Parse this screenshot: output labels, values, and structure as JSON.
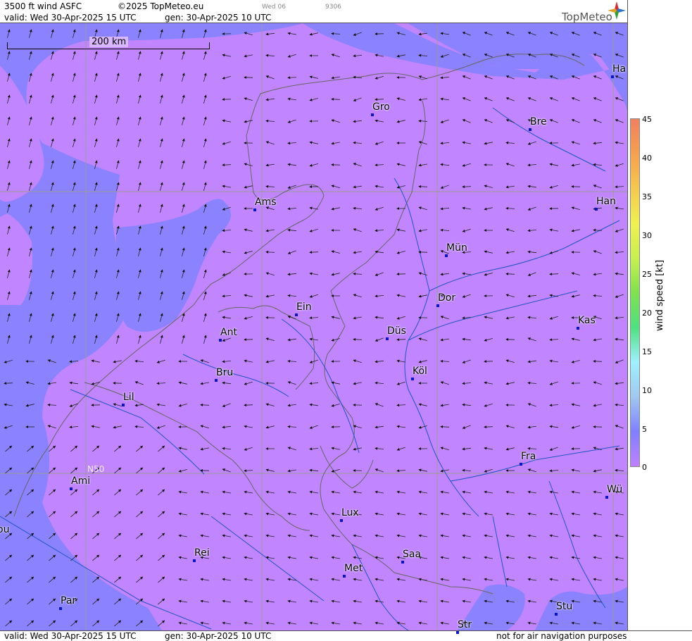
{
  "header": {
    "product": "3500 ft wind ASFC",
    "copyright": "©2025 TopMeteo.eu",
    "valid": "valid:  Wed  30-Apr-2025  15 UTC",
    "generated": "gen: 30-Apr-2025 10 UTC",
    "small1": "Wed 06",
    "small2": "9306",
    "brand": "TopMeteo"
  },
  "footer": {
    "valid": "valid:  Wed  30-Apr-2025  15 UTC",
    "generated": "gen: 30-Apr-2025 10 UTC",
    "disclaimer": "not for air navigation purposes"
  },
  "map": {
    "scale_label": "200 km",
    "grid_label": "N50",
    "cities": [
      {
        "name": "Gro"
      },
      {
        "name": "Bre"
      },
      {
        "name": "Ha"
      },
      {
        "name": "Ams"
      },
      {
        "name": "Han"
      },
      {
        "name": "Mün"
      },
      {
        "name": "Dor"
      },
      {
        "name": "Ein"
      },
      {
        "name": "Kas"
      },
      {
        "name": "Ant"
      },
      {
        "name": "Düs"
      },
      {
        "name": "Köl"
      },
      {
        "name": "Bru"
      },
      {
        "name": "Lil"
      },
      {
        "name": "Fra"
      },
      {
        "name": "Ami"
      },
      {
        "name": "Wü"
      },
      {
        "name": "Lux"
      },
      {
        "name": "ou"
      },
      {
        "name": "Rei"
      },
      {
        "name": "Saa"
      },
      {
        "name": "Met"
      },
      {
        "name": "Par"
      },
      {
        "name": "Stu"
      },
      {
        "name": "Str"
      }
    ]
  },
  "legend": {
    "unit": "wind  speed  [kt]",
    "ticks": [
      "45",
      "40",
      "35",
      "30",
      "25",
      "20",
      "15",
      "10",
      "5",
      "0"
    ],
    "colors": [
      "#f08060",
      "#f5a050",
      "#f5c850",
      "#f0f050",
      "#c8f050",
      "#80e050",
      "#50e080",
      "#a0f0ff",
      "#a0c8f0",
      "#8080ff",
      "#c080ff"
    ]
  },
  "palette": {
    "violet": "#c085ff",
    "blue": "#8a82ff",
    "line": "#555555",
    "river": "#2255cc",
    "dot": "#0a14c8"
  }
}
